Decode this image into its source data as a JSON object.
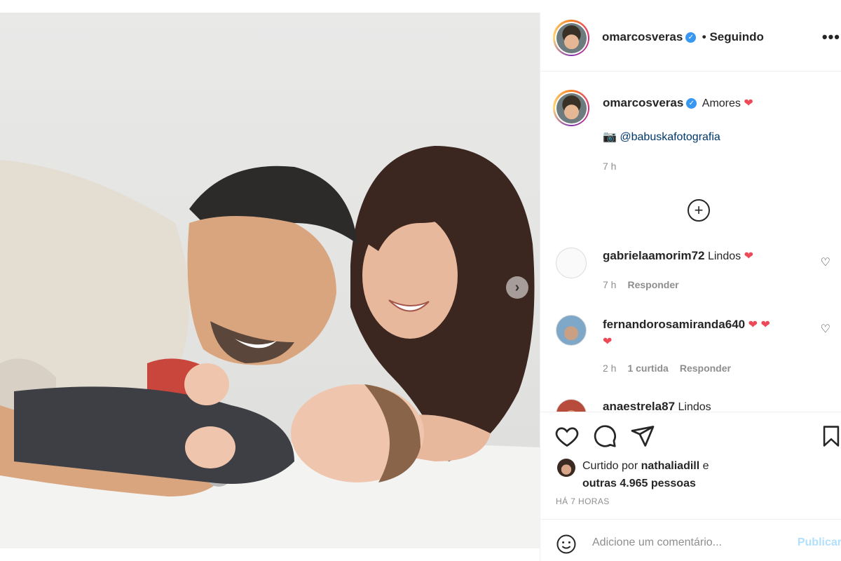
{
  "post": {
    "author": "omarcosveras",
    "follow_status": "• Seguindo",
    "more_icon": "more-dots-icon",
    "next_icon": "chevron-right-icon"
  },
  "caption": {
    "username": "omarcosveras",
    "text": "Amores",
    "emoji": "❤",
    "camera_emoji": "📷",
    "credit": "@babuskafotografia",
    "time": "7 h"
  },
  "load_more_icon": "plus-circle-icon",
  "comments": [
    {
      "username": "gabrielaamorim72",
      "text": "Lindos",
      "emoji": "❤",
      "time": "7 h",
      "likes": "",
      "reply": "Responder"
    },
    {
      "username": "fernandorosamiranda640",
      "text": "",
      "emoji": "❤ ❤",
      "emoji_line2": "❤",
      "time": "2 h",
      "likes": "1 curtida",
      "reply": "Responder"
    },
    {
      "username": "anaestrela87",
      "text": "Lindos",
      "emoji": "",
      "time": "",
      "likes": "",
      "reply": ""
    }
  ],
  "actions": {
    "like_icon": "heart-outline-icon",
    "comment_icon": "comment-icon",
    "share_icon": "share-icon",
    "save_icon": "bookmark-icon"
  },
  "likes": {
    "prefix": "Curtido por",
    "user": "nathaliadill",
    "connector": "e",
    "others": "outras 4.965 pessoas"
  },
  "posted_ago": "HÁ 7 HORAS",
  "add_comment": {
    "emoji_icon": "smiley-icon",
    "placeholder": "Adicione um comentário...",
    "publish_label": "Publicar"
  },
  "colors": {
    "link": "#00376b",
    "verified": "#3897f0",
    "heart": "#ed4956",
    "muted": "#8e8e8e",
    "publish_disabled": "#b2dffc"
  }
}
